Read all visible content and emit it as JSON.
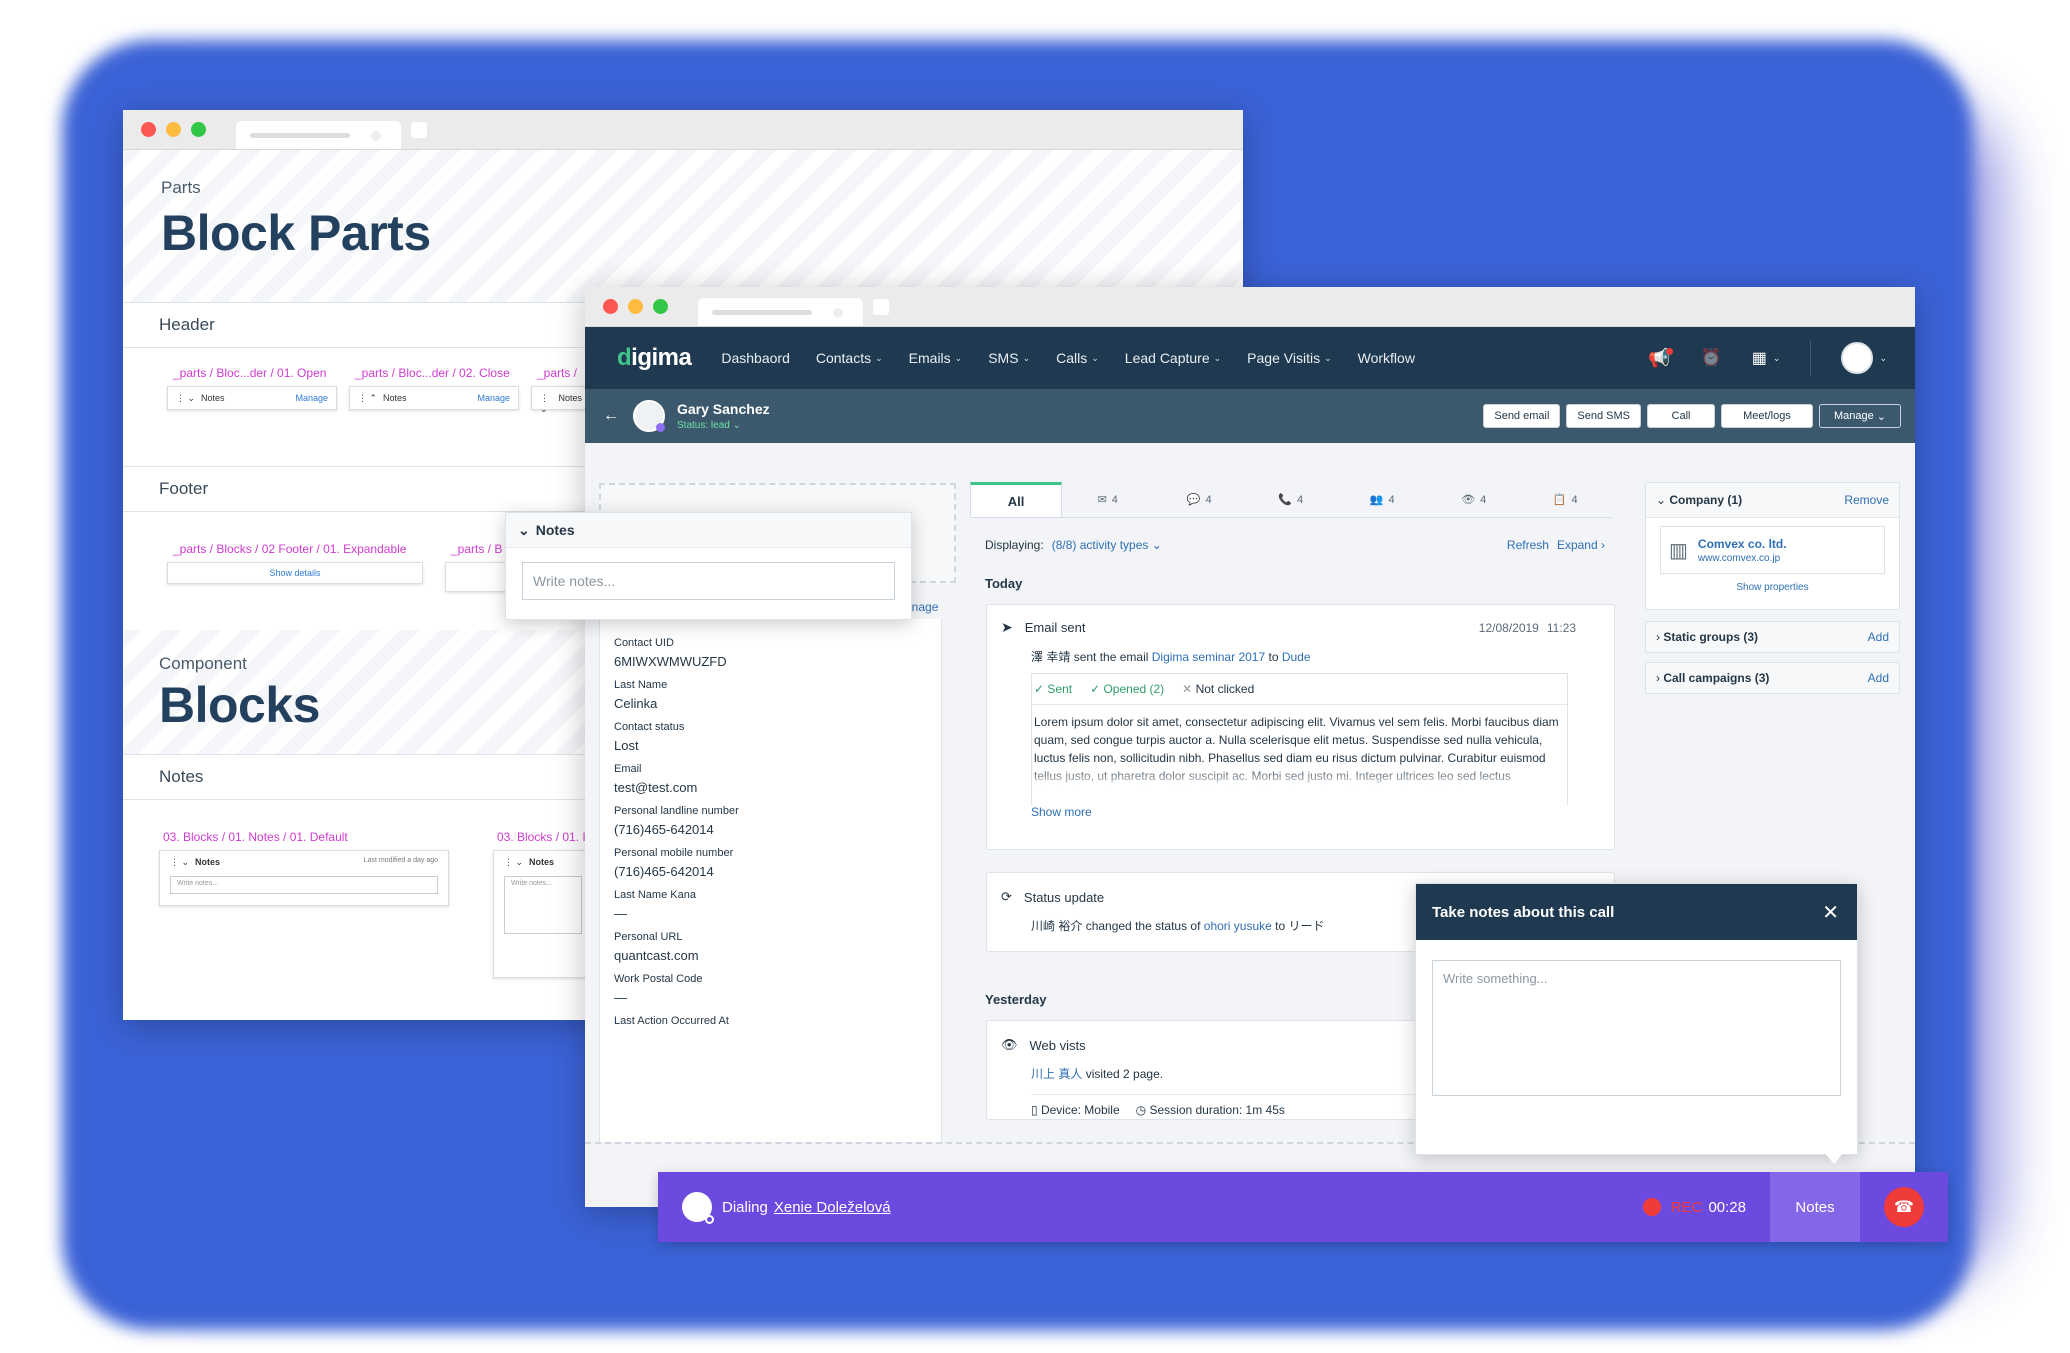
{
  "back_window": {
    "parts_label": "Parts",
    "parts_title": "Block Parts",
    "header_section": "Header",
    "header_items": [
      {
        "path": "_parts / Bloc...der / 01. Open",
        "title": "Notes",
        "manage": "Manage"
      },
      {
        "path": "_parts / Bloc...der / 02. Close",
        "title": "Notes",
        "manage": "Manage"
      },
      {
        "path": "_parts /",
        "title": "Notes"
      }
    ],
    "footer_section": "Footer",
    "footer_items": [
      {
        "path": "_parts / Blocks / 02 Footer / 01. Expandable",
        "button": "Show details"
      },
      {
        "path": "_parts / B"
      }
    ],
    "component_label": "Component",
    "component_title": "Blocks",
    "notes_section": "Notes",
    "notes_items": [
      {
        "path": "03. Blocks / 01. Notes / 01. Default",
        "title": "Notes",
        "meta": "Last modified a day ago",
        "placeholder": "Write notes..."
      },
      {
        "path": "03. Blocks / 01. I",
        "title": "Notes",
        "placeholder": "Write notes..."
      }
    ],
    "floating_notes": {
      "title": "Notes",
      "placeholder": "Write notes...",
      "manage_fragment": "anage"
    }
  },
  "nav": {
    "logo": "digima",
    "items": [
      {
        "label": "Dashbaord",
        "dropdown": false
      },
      {
        "label": "Contacts",
        "dropdown": true
      },
      {
        "label": "Emails",
        "dropdown": true
      },
      {
        "label": "SMS",
        "dropdown": true
      },
      {
        "label": "Calls",
        "dropdown": true
      },
      {
        "label": "Lead Capture",
        "dropdown": true
      },
      {
        "label": "Page Visitis",
        "dropdown": true
      },
      {
        "label": "Workflow",
        "dropdown": false
      }
    ]
  },
  "contact": {
    "name": "Gary Sanchez",
    "status": "Status: lead",
    "actions": [
      "Send email",
      "Send SMS",
      "Call",
      "Meet/logs",
      "Manage"
    ]
  },
  "fields": [
    {
      "label": "Contact UID",
      "value": "6MIWXWMWUZFD"
    },
    {
      "label": "Last Name",
      "value": "Celinka"
    },
    {
      "label": "Contact status",
      "value": "Lost"
    },
    {
      "label": "Email",
      "value": "test@test.com"
    },
    {
      "label": "Personal landline number",
      "value": "(716)465-642014"
    },
    {
      "label": "Personal mobile number",
      "value": "(716)465-642014"
    },
    {
      "label": "Last Name Kana",
      "value": "—"
    },
    {
      "label": "Personal URL",
      "value": "quantcast.com"
    },
    {
      "label": "Work Postal Code",
      "value": "—"
    },
    {
      "label": "Last Action Occurred At",
      "value": ""
    }
  ],
  "activity_tabs": [
    {
      "label": "All",
      "icon": "list-icon"
    },
    {
      "label": "4",
      "icon": "mail-icon"
    },
    {
      "label": "4",
      "icon": "chat-icon"
    },
    {
      "label": "4",
      "icon": "phone-icon"
    },
    {
      "label": "4",
      "icon": "group-icon"
    },
    {
      "label": "4",
      "icon": "eye-icon"
    },
    {
      "label": "4",
      "icon": "clipboard-icon"
    }
  ],
  "filter": {
    "displaying": "Displaying:",
    "types": "(8/8) activity types",
    "refresh": "Refresh",
    "expand": "Expand"
  },
  "today": "Today",
  "yesterday": "Yesterday",
  "email_sent": {
    "title": "Email sent",
    "date": "12/08/2019",
    "time": "11:23",
    "sender": "澤 幸靖",
    "sent_text": "sent the email",
    "subject": "Digima seminar 2017",
    "to": "to",
    "recipient": "Dude",
    "sent": "Sent",
    "opened": "Opened (2)",
    "not_clicked": "Not clicked",
    "body": "Lorem ipsum dolor sit amet, consectetur adipiscing elit. Vivamus vel sem felis. Morbi faucibus diam quam, sed congue turpis auctor a. Nulla scelerisque elit metus. Suspendisse sed nulla vehicula, luctus felis non, sollicitudin nibh. Phasellus sed diam eu risus dictum pulvinar. Curabitur euismod tellus justo, ut pharetra dolor suscipit ac. Morbi sed justo mi. Integer ultrices leo sed lectus dignissim, quis gravida nulla lacinia. Phasellus diam enim, lobortis quis sollicitudin nec,",
    "show_more": "Show more"
  },
  "status_update": {
    "title": "Status update",
    "actor": "川崎 裕介",
    "changed": "changed the status of",
    "target": "ohori yusuke",
    "to": "to",
    "new_status": "リード"
  },
  "web_visits": {
    "title": "Web vists",
    "visitor": "川上 真人",
    "visited": "visited 2 page.",
    "device": "Device: Mobile",
    "session": "Session duration: 1m 45s"
  },
  "right_panel": {
    "company_header": "Company (1)",
    "remove": "Remove",
    "company_name": "Comvex co. ltd.",
    "company_url": "www.comvex.co.jp",
    "show_properties": "Show properties",
    "static_groups": "Static groups (3)",
    "call_campaigns": "Call campaigns (3)",
    "add": "Add"
  },
  "call_notes": {
    "title": "Take notes about this call",
    "placeholder": "Write something..."
  },
  "callbar": {
    "dialing": "Dialing",
    "name": "Xenie Doleželová",
    "rec": "REC",
    "timer": "00:28",
    "notes": "Notes"
  },
  "colors": {
    "accent": "#3fc58b",
    "nav": "#1f3a50",
    "callbar": "#6c4ae0",
    "link": "#2f6fb5",
    "rec": "#f03b3b",
    "pink": "#d13bd1"
  }
}
